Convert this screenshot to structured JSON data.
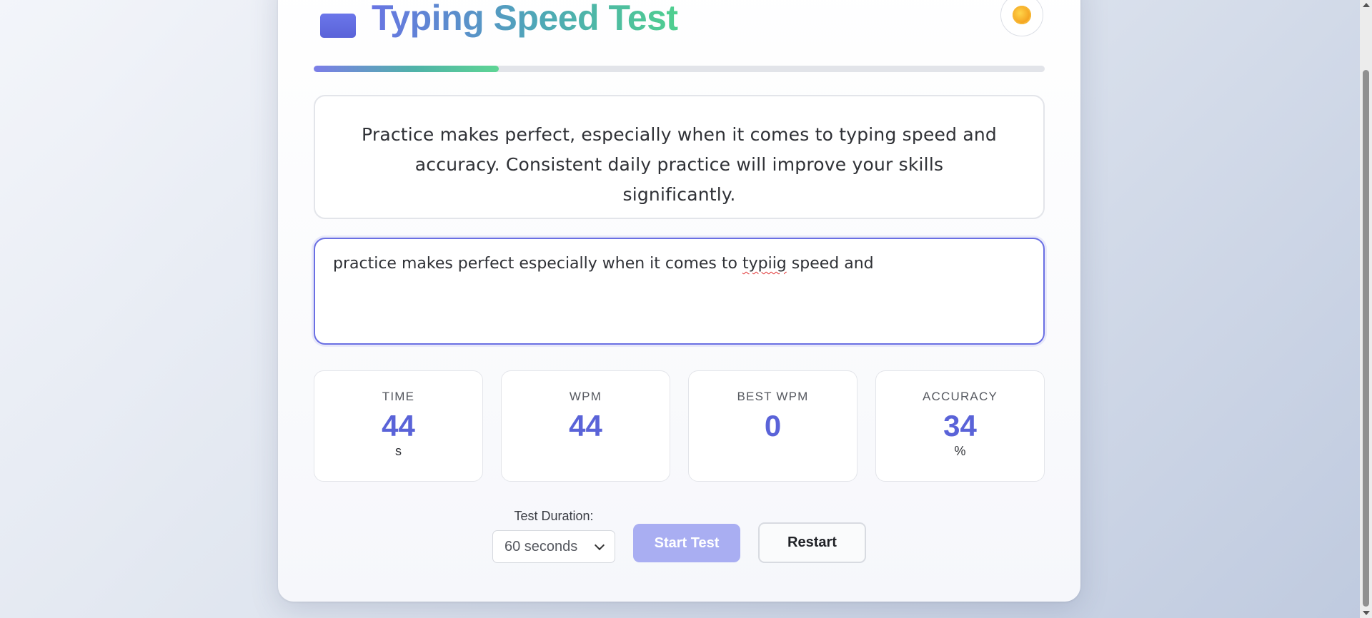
{
  "header": {
    "title": "Typing Speed Test",
    "logo_icon": "keyboard-icon",
    "theme_icon": "sun-icon"
  },
  "progress": {
    "fraction": 0.253
  },
  "passage": {
    "text": "Practice makes perfect, especially when it comes to typing speed and accuracy. Consistent daily practice will improve your skills significantly."
  },
  "input": {
    "before": "practice makes perfect especially when it comes to ",
    "misspelled": "typiig",
    "after": " speed and"
  },
  "stats": [
    {
      "label": "TIME",
      "value": "44",
      "unit": "s"
    },
    {
      "label": "WPM",
      "value": "44",
      "unit": ""
    },
    {
      "label": "BEST WPM",
      "value": "0",
      "unit": ""
    },
    {
      "label": "ACCURACY",
      "value": "34",
      "unit": "%"
    }
  ],
  "controls": {
    "duration_label": "Test Duration:",
    "duration_selected": "60 seconds",
    "start_label": "Start Test",
    "restart_label": "Restart"
  },
  "colors": {
    "accent": "#5a63d8",
    "focus_border": "#6a6fe3",
    "start_button_disabled": "#a9aef2"
  }
}
